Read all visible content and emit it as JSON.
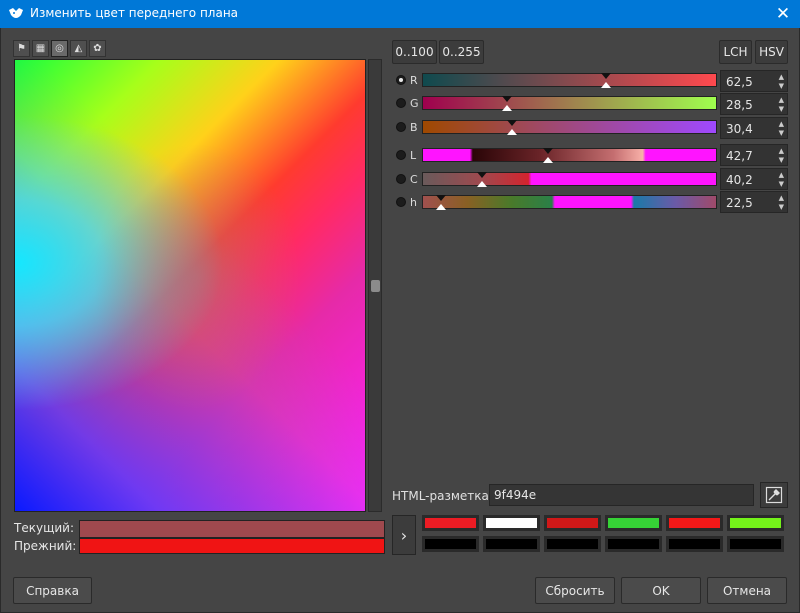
{
  "window": {
    "title": "Изменить цвет переднего плана",
    "close_label": "✕"
  },
  "selector_tabs": [
    {
      "icon": "gimp-icon",
      "glyph": "⚑"
    },
    {
      "icon": "cmyk-icon",
      "glyph": "▦"
    },
    {
      "icon": "color-wheel-icon",
      "glyph": "◎"
    },
    {
      "icon": "triangle-icon",
      "glyph": "◭"
    },
    {
      "icon": "watercolor-icon",
      "glyph": "✿"
    }
  ],
  "range_buttons": {
    "r100": "0..100",
    "r255": "0..255"
  },
  "mode_buttons": {
    "lch": "LCH",
    "hsv": "HSV"
  },
  "channels": [
    {
      "letter": "R",
      "value": "62,5",
      "selected": true,
      "fraction": 0.625
    },
    {
      "letter": "G",
      "value": "28,5",
      "selected": false,
      "fraction": 0.285
    },
    {
      "letter": "B",
      "value": "30,4",
      "selected": false,
      "fraction": 0.304
    },
    {
      "letter": "L",
      "value": "42,7",
      "selected": false,
      "fraction": 0.427
    },
    {
      "letter": "C",
      "value": "40,2",
      "selected": false,
      "fraction": 0.201
    },
    {
      "letter": "h",
      "value": "22,5",
      "selected": false,
      "fraction": 0.0625
    }
  ],
  "current_label": "Текущий:",
  "previous_label": "Прежний:",
  "current_color": "#9f494e",
  "previous_color": "#f01414",
  "html_label": "HTML-разметка:",
  "html_value": "9f494e",
  "history_top": [
    "#ec1c24",
    "#ffffff",
    "#d01818",
    "#36d236",
    "#f31818",
    "#74f21a"
  ],
  "history_bottom": [
    "#000000",
    "#000000",
    "#000000",
    "#000000",
    "#000000",
    "#000000"
  ],
  "buttons": {
    "help": "Справка",
    "reset": "Сбросить",
    "ok": "OK",
    "cancel": "Отмена"
  }
}
